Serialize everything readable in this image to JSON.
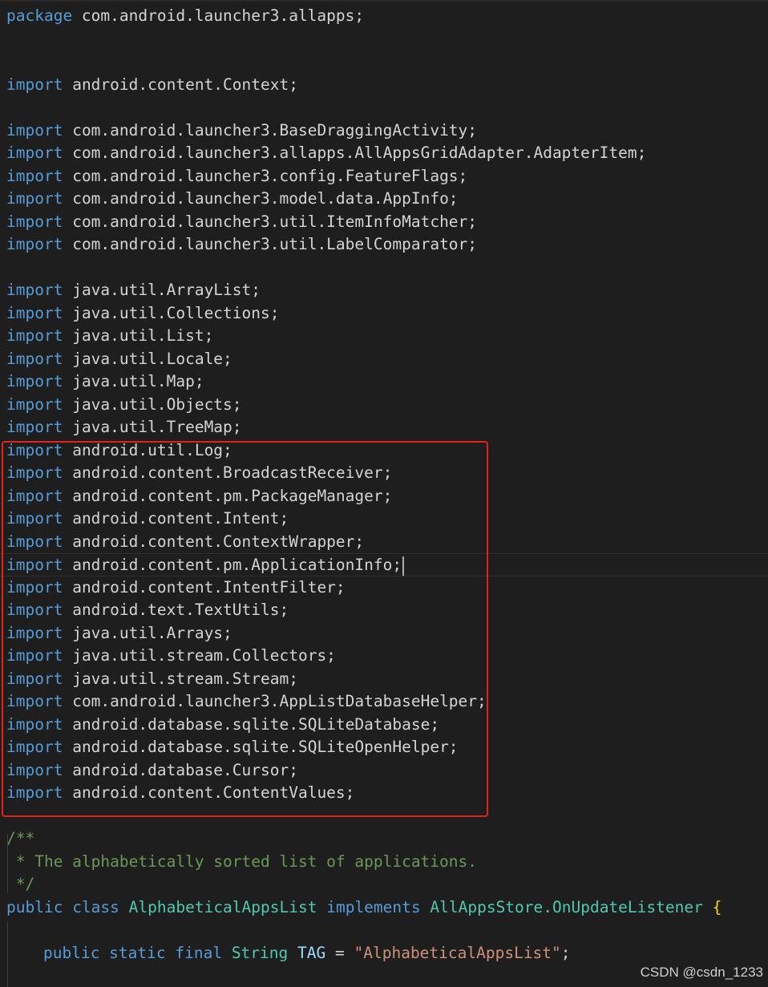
{
  "editor": {
    "language": "java",
    "lines": {
      "package_kw": "package",
      "package_name": " com.android.launcher3.allapps;",
      "import_kw": "import",
      "imports": [
        "android.content.Context;",
        "com.android.launcher3.BaseDraggingActivity;",
        "com.android.launcher3.allapps.AllAppsGridAdapter.AdapterItem;",
        "com.android.launcher3.config.FeatureFlags;",
        "com.android.launcher3.model.data.AppInfo;",
        "com.android.launcher3.util.ItemInfoMatcher;",
        "com.android.launcher3.util.LabelComparator;",
        "java.util.ArrayList;",
        "java.util.Collections;",
        "java.util.List;",
        "java.util.Locale;",
        "java.util.Map;",
        "java.util.Objects;",
        "java.util.TreeMap;",
        "android.util.Log;",
        "android.content.BroadcastReceiver;",
        "android.content.pm.PackageManager;",
        "android.content.Intent;",
        "android.content.ContextWrapper;",
        "android.content.pm.ApplicationInfo;",
        "android.content.IntentFilter;",
        "android.text.TextUtils;",
        "java.util.Arrays;",
        "java.util.stream.Collectors;",
        "java.util.stream.Stream;",
        "com.android.launcher3.AppListDatabaseHelper;",
        "android.database.sqlite.SQLiteDatabase;",
        "android.database.sqlite.SQLiteOpenHelper;",
        "android.database.Cursor;",
        "android.content.ContentValues;"
      ],
      "comment_open": "/**",
      "comment_body": " * The alphabetically sorted list of applications.",
      "comment_close": " */",
      "class_decl": {
        "public": "public",
        "class": "class",
        "name": "AlphabeticalAppsList",
        "implements": "implements",
        "interface": "AllAppsStore.OnUpdateListener",
        "brace": "{"
      },
      "field_decl": {
        "modifiers": "public static final",
        "type": "String",
        "name": "TAG",
        "eq": "=",
        "value": "\"AlphabeticalAppsList\"",
        "semi": ";"
      }
    }
  },
  "watermark": "CSDN @csdn_1233",
  "colors": {
    "background": "#1e1e1e",
    "keyword": "#569cd6",
    "type": "#4ec9b0",
    "string": "#ce9178",
    "comment": "#6a9955",
    "highlight_box": "#e2231a"
  }
}
